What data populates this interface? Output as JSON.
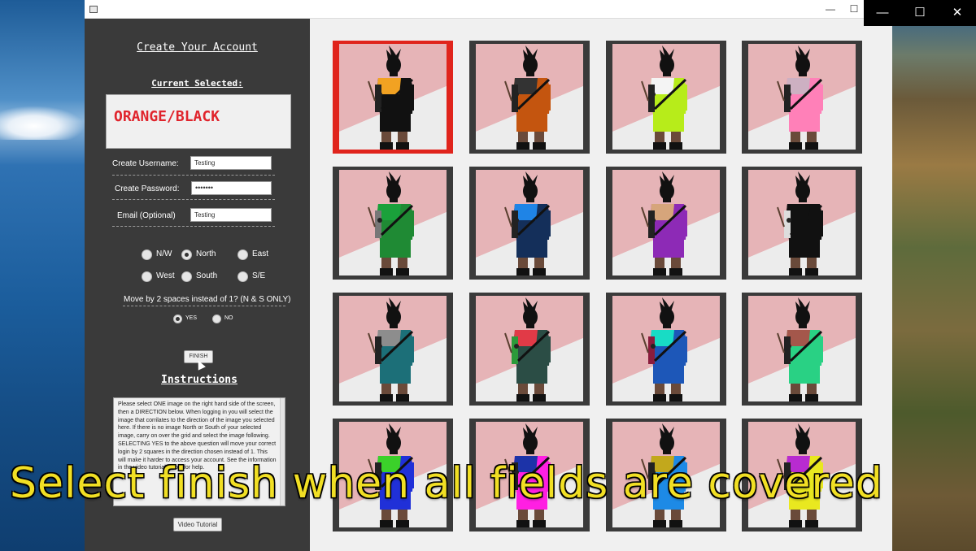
{
  "window": {
    "minimize_glyph": "—",
    "maximize_glyph": "☐"
  },
  "system_controls": {
    "minimize": "—",
    "maximize": "☐",
    "close": "✕"
  },
  "form": {
    "title": "Create Your Account",
    "current_label": "Current Selected:",
    "current_value": "ORANGE/BLACK",
    "username_label": "Create Username:",
    "username_value": "Testing",
    "password_label": "Create Password:",
    "password_value": "•••••••",
    "email_label": "Email (Optional)",
    "email_value": "Testing",
    "directions": [
      {
        "label": "N/W",
        "checked": false
      },
      {
        "label": "North",
        "checked": true
      },
      {
        "label": "East",
        "checked": false
      },
      {
        "label": "West",
        "checked": false
      },
      {
        "label": "South",
        "checked": false
      },
      {
        "label": "S/E",
        "checked": false
      }
    ],
    "move_label": "Move by 2 spaces instead of 1? (N & S ONLY)",
    "move_options": [
      {
        "label": "YES",
        "checked": true
      },
      {
        "label": "NO",
        "checked": false
      }
    ],
    "finish_label": "FINISH",
    "instructions_title": "Instructions",
    "instructions_text": "Please select ONE image on the right hand side of the screen, then a DIRECTION below. When logging in you will select the image that corrilates to the direction of the image you selected here. If there is no image North or South of your selected image, carry on over the grid and select the image following. SELECTING YES to the above question will move your correct login by 2 squares in the direction chosen instead of 1. This will make it harder to access your account. See the information in the video tutorial below for help.",
    "video_label": "Video Tutorial"
  },
  "grid": {
    "selected_index": 0,
    "tiles": [
      {
        "name": "orange-black",
        "top": "#f2a222",
        "bottom": "#111111",
        "accent": "#222222"
      },
      {
        "name": "black-orange",
        "top": "#333333",
        "bottom": "#c4550f",
        "accent": "#222222"
      },
      {
        "name": "white-lime",
        "top": "#f4f4f4",
        "bottom": "#b7ec1a",
        "accent": "#222222"
      },
      {
        "name": "pink-lilac",
        "top": "#cdb0c2",
        "bottom": "#ff80b8",
        "accent": "#222222"
      },
      {
        "name": "green-gray",
        "top": "#1aa13b",
        "bottom": "#1f8a34",
        "accent": "#777777"
      },
      {
        "name": "blue-navy",
        "top": "#1f84e6",
        "bottom": "#142f5a",
        "accent": "#222222"
      },
      {
        "name": "tan-purple",
        "top": "#d6a57b",
        "bottom": "#8d2ab6",
        "accent": "#222222"
      },
      {
        "name": "white-black",
        "top": "#111111",
        "bottom": "#111111",
        "accent": "#dddddd"
      },
      {
        "name": "gray-teal",
        "top": "#8d8d8d",
        "bottom": "#1c6f78",
        "accent": "#222222"
      },
      {
        "name": "red-darkteal",
        "top": "#e13a47",
        "bottom": "#2b4d45",
        "accent": "#2c9a3a"
      },
      {
        "name": "aqua-blue",
        "top": "#18dcc5",
        "bottom": "#1d57b8",
        "accent": "#8a1d3d"
      },
      {
        "name": "brown-mint",
        "top": "#a4574b",
        "bottom": "#29d184",
        "accent": "#222222"
      },
      {
        "name": "green-blue",
        "top": "#3bd12a",
        "bottom": "#2030d8",
        "accent": "#222222"
      },
      {
        "name": "navy-magenta",
        "top": "#1c33a8",
        "bottom": "#ff1fe2",
        "accent": "#222222"
      },
      {
        "name": "gold-sky",
        "top": "#c2a81c",
        "bottom": "#1d8ae6",
        "accent": "#222222"
      },
      {
        "name": "purple-yellow",
        "top": "#b82bd0",
        "bottom": "#e9e81f",
        "accent": "#222222"
      }
    ]
  },
  "caption": "Select finish when all fields are covered"
}
